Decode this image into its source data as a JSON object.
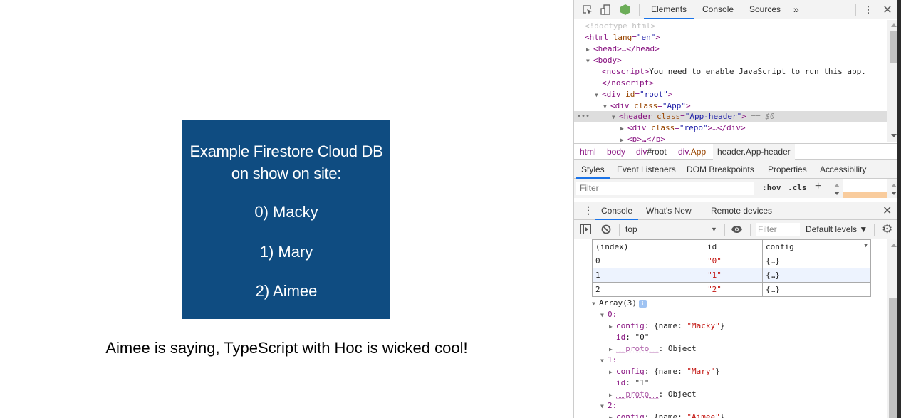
{
  "page": {
    "header": {
      "title_line1": "Example Firestore Cloud DB",
      "title_line2": "on show on site:",
      "items": [
        "0) Macky",
        "1) Mary",
        "2) Aimee"
      ],
      "bg_color": "#0f4c81"
    },
    "saying": "Aimee is saying, TypeScript with Hoc is wicked cool!"
  },
  "devtools": {
    "top_tabs": [
      {
        "label": "Elements",
        "active": true
      },
      {
        "label": "Console",
        "active": false
      },
      {
        "label": "Sources",
        "active": false
      }
    ],
    "more_tabs_label": "»",
    "icons": {
      "inspect": "inspect-element-icon",
      "device": "device-toolbar-icon",
      "node": "node-js-icon",
      "menu": "kebab-menu-icon",
      "close": "close-icon"
    },
    "elements_tree": {
      "doctype": "<!doctype html>",
      "html_open_tag": "html",
      "html_lang_attr": "lang",
      "html_lang_val": "\"en\"",
      "head": "<head>…</head>",
      "body": "<body>",
      "noscript_open": "<noscript>",
      "noscript_text": "You need to enable JavaScript to run this app.",
      "noscript_close": "</noscript>",
      "div_root_tag": "div",
      "div_root_attr": "id",
      "div_root_val": "\"root\"",
      "div_app_tag": "div",
      "div_app_attr": "class",
      "div_app_val": "\"App\"",
      "header_tag": "header",
      "header_attr": "class",
      "header_val": "\"App-header\"",
      "selected_marker": "== $0",
      "repo_tag": "div",
      "repo_attr": "class",
      "repo_val": "\"repo\"",
      "repo_close": ">…</div>",
      "p_line": "<p>…</p>"
    },
    "breadcrumbs": [
      {
        "tag": "html",
        "suffix": ""
      },
      {
        "tag": "body",
        "suffix": ""
      },
      {
        "tag": "div",
        "suffix": "#root"
      },
      {
        "tag": "div",
        "suffix": ".App"
      },
      {
        "tag": "header.App-header",
        "suffix": "",
        "active": true
      }
    ],
    "styles_tabs": [
      "Styles",
      "Event Listeners",
      "DOM Breakpoints",
      "Properties",
      "Accessibility"
    ],
    "styles_filter_placeholder": "Filter",
    "hov_label": ":hov",
    "cls_label": ".cls",
    "plus_label": "+",
    "drawer_tabs": [
      {
        "label": "Console",
        "active": true
      },
      {
        "label": "What's New",
        "active": false
      },
      {
        "label": "Remote devices",
        "active": false
      }
    ],
    "console_toolbar": {
      "context": "top",
      "filter_placeholder": "Filter",
      "levels": "Default levels ▼"
    },
    "console_table": {
      "headers": [
        "(index)",
        "id",
        "config"
      ],
      "rows": [
        {
          "index": "0",
          "id": "\"0\"",
          "config": "{…}"
        },
        {
          "index": "1",
          "id": "\"1\"",
          "config": "{…}"
        },
        {
          "index": "2",
          "id": "\"2\"",
          "config": "{…}"
        }
      ]
    },
    "console_tree": {
      "array_label": "Array(3)",
      "info": "i",
      "entries": [
        {
          "key": "0:",
          "config_key": "config",
          "config_pre": ": {name: ",
          "config_name": "\"Macky\"",
          "config_post": "}",
          "id_key": "id",
          "id_val": "\"0\"",
          "proto_key": "__proto__",
          "proto_val": ": Object"
        },
        {
          "key": "1:",
          "config_key": "config",
          "config_pre": ": {name: ",
          "config_name": "\"Mary\"",
          "config_post": "}",
          "id_key": "id",
          "id_val": "\"1\"",
          "proto_key": "__proto__",
          "proto_val": ": Object"
        },
        {
          "key": "2:",
          "config_key": "config",
          "config_pre": ": {name: ",
          "config_name": "\"Aimee\"",
          "config_post": "}"
        }
      ]
    }
  }
}
